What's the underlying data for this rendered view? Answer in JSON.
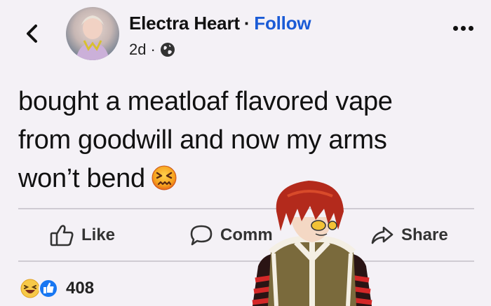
{
  "post": {
    "author": "Electra Heart",
    "separator": "·",
    "follow_label": "Follow",
    "time": "2d",
    "time_separator": "·",
    "audience_icon": "globe-icon",
    "text_lines": [
      "bought a meatloaf flavored vape",
      "from goodwill and now my arms",
      "won’t bend"
    ],
    "emoji": "confounded-face"
  },
  "actions": {
    "like": "Like",
    "comment": "Comm",
    "share": "Share"
  },
  "reactions": {
    "icons": [
      "laugh-reaction-icon",
      "like-reaction-icon"
    ],
    "count": "408"
  },
  "colors": {
    "background": "#f4f1f6",
    "follow": "#1a5bd6",
    "divider": "#cfcbd3",
    "like_blue": "#1877f2",
    "laugh_yellow": "#f7c948"
  }
}
